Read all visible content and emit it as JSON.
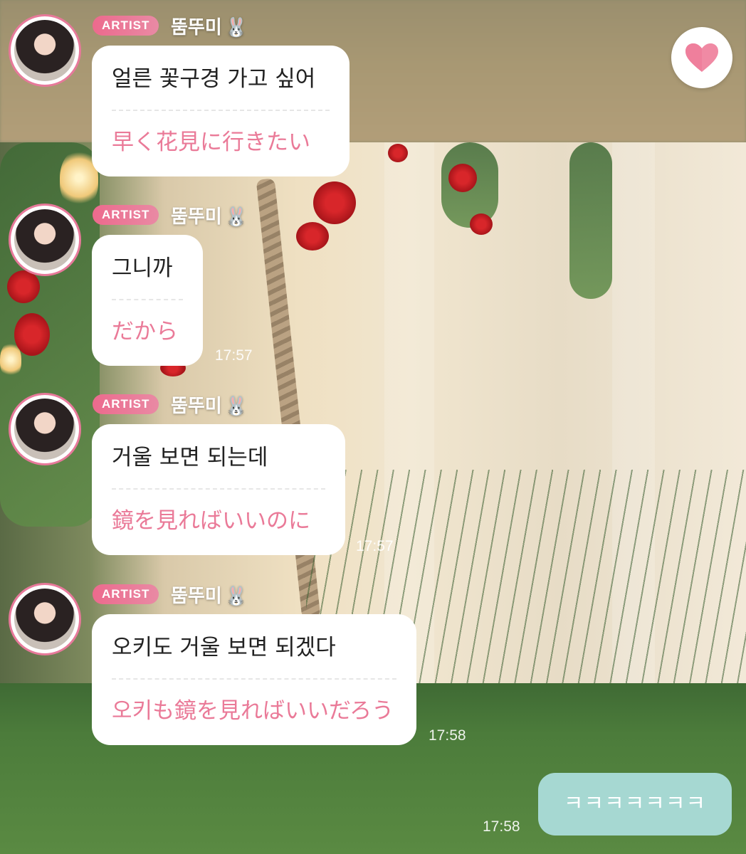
{
  "colors": {
    "accent_pink": "#ea7a98",
    "badge_pink": "#ec6a8d",
    "my_bubble": "#a6d8d2"
  },
  "messages": [
    {
      "badge": "ARTIST",
      "sender": "뚬뚜미",
      "sender_emoji": "🐰",
      "text_ko": "얼른 꽃구경 가고 싶어",
      "text_ja": "早く花見に行きたい",
      "time": ""
    },
    {
      "badge": "ARTIST",
      "sender": "뚬뚜미",
      "sender_emoji": "🐰",
      "text_ko": "그니까",
      "text_ja": "だから",
      "time": "17:57"
    },
    {
      "badge": "ARTIST",
      "sender": "뚬뚜미",
      "sender_emoji": "🐰",
      "text_ko": "거울 보면 되는데",
      "text_ja": "鏡を見ればいいのに",
      "time": "17:57"
    },
    {
      "badge": "ARTIST",
      "sender": "뚬뚜미",
      "sender_emoji": "🐰",
      "text_ko": "오키도 거울 보면 되겠다",
      "text_ja": "오키も鏡を見ればいいだろう",
      "time": "17:58"
    }
  ],
  "my_message": {
    "text": "ㅋㅋㅋㅋㅋㅋㅋ",
    "time": "17:58"
  },
  "heart_button": {
    "icon": "heart-icon"
  }
}
